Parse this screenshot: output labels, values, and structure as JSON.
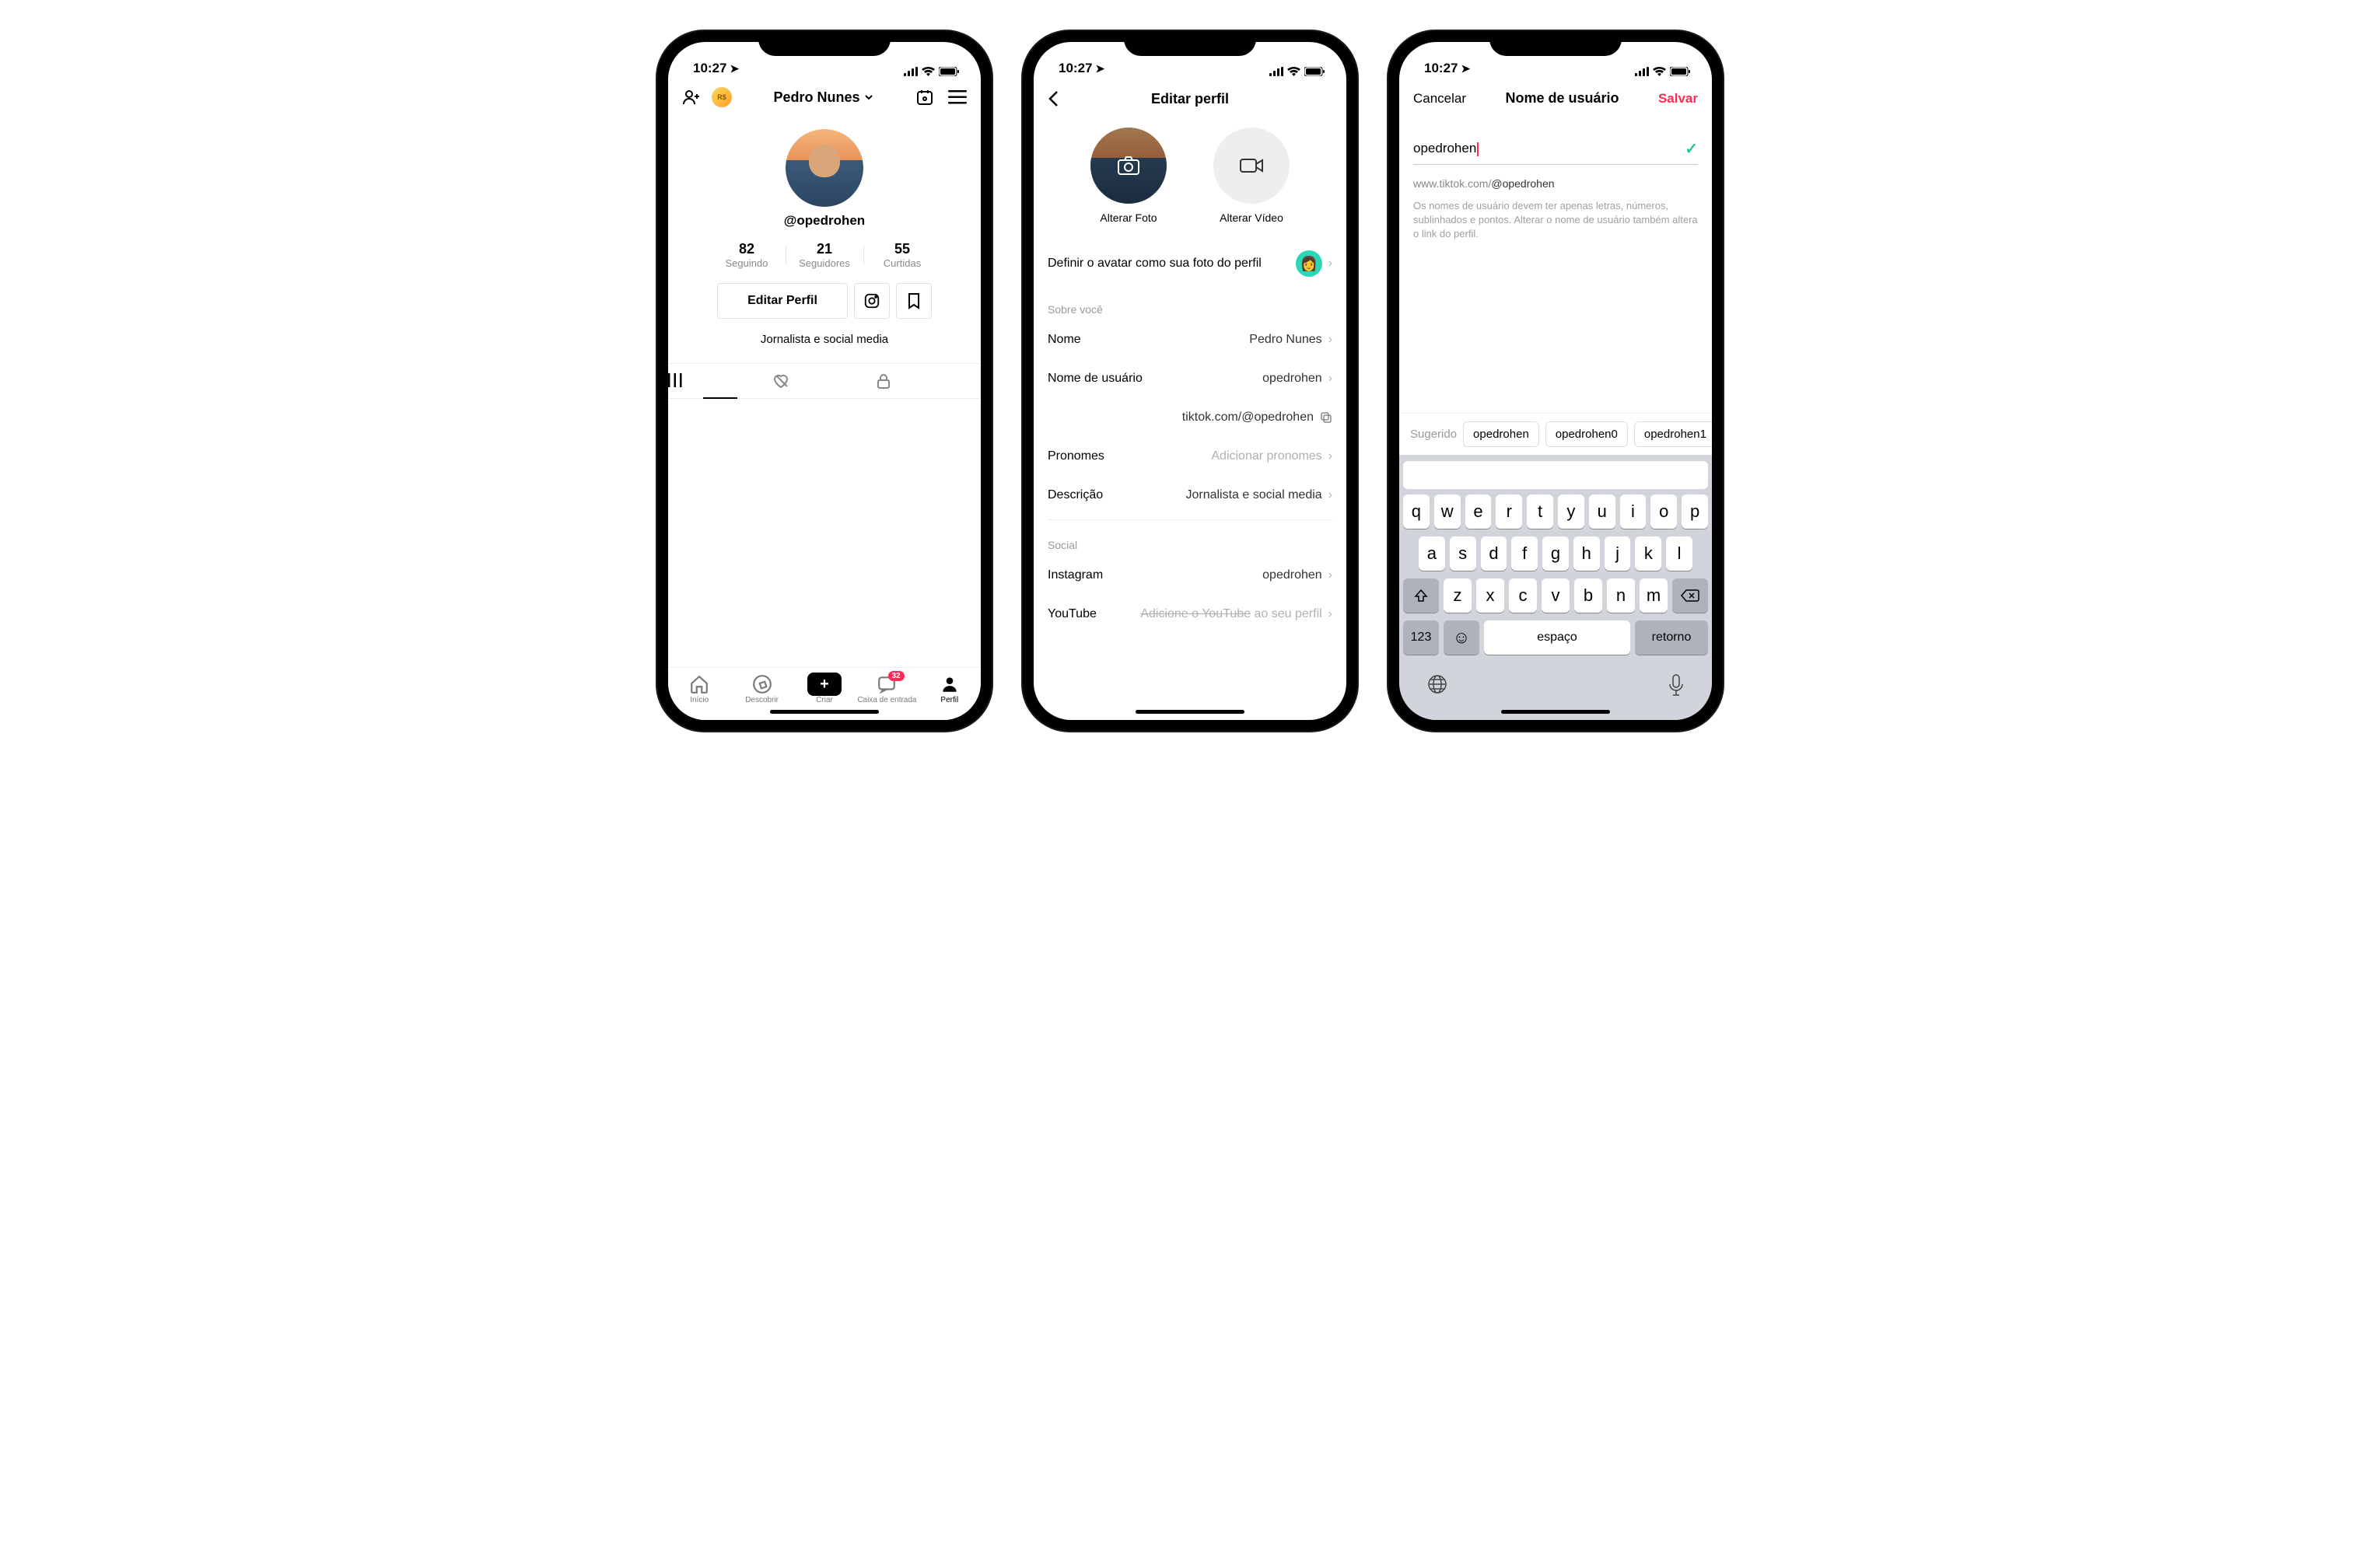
{
  "status": {
    "time": "10:27"
  },
  "phone1": {
    "header": {
      "profile_name": "Pedro Nunes"
    },
    "username": "@opedrohen",
    "stats": {
      "following": {
        "num": "82",
        "label": "Seguindo"
      },
      "followers": {
        "num": "21",
        "label": "Seguidores"
      },
      "likes": {
        "num": "55",
        "label": "Curtidas"
      }
    },
    "edit_button": "Editar Perfil",
    "bio": "Jornalista e social media",
    "nav": {
      "home": "Início",
      "discover": "Descobrir",
      "create": "Criar",
      "inbox": "Caixa de entrada",
      "inbox_badge": "32",
      "profile": "Perfil"
    }
  },
  "phone2": {
    "title": "Editar perfil",
    "media": {
      "photo_label": "Alterar Foto",
      "video_label": "Alterar Vídeo"
    },
    "avatar_row": "Definir o avatar como sua foto do perfil",
    "section_about": "Sobre você",
    "rows": {
      "name": {
        "label": "Nome",
        "value": "Pedro Nunes"
      },
      "username": {
        "label": "Nome de usuário",
        "value": "opedrohen"
      },
      "profile_link": "tiktok.com/@opedrohen",
      "pronouns": {
        "label": "Pronomes",
        "placeholder": "Adicionar pronomes"
      },
      "description": {
        "label": "Descrição",
        "value": "Jornalista e social media"
      }
    },
    "section_social": "Social",
    "social": {
      "instagram": {
        "label": "Instagram",
        "value": "opedrohen"
      },
      "youtube": {
        "label": "YouTube",
        "placeholder_strike": "Adicione o YouTube",
        "placeholder_rest": " ao seu perfil"
      }
    }
  },
  "phone3": {
    "cancel": "Cancelar",
    "title": "Nome de usuário",
    "save": "Salvar",
    "input_value": "opedrohen",
    "url_prefix": "www.tiktok.com/",
    "url_handle": "@opedrohen",
    "help": "Os nomes de usuário devem ter apenas letras, números, sublinhados e pontos. Alterar o nome de usuário também altera o link do perfil.",
    "suggestions": {
      "label": "Sugerido",
      "items": [
        "opedrohen",
        "opedrohen0",
        "opedrohen1"
      ]
    },
    "keyboard": {
      "row1": [
        "q",
        "w",
        "e",
        "r",
        "t",
        "y",
        "u",
        "i",
        "o",
        "p"
      ],
      "row2": [
        "a",
        "s",
        "d",
        "f",
        "g",
        "h",
        "j",
        "k",
        "l"
      ],
      "row3": [
        "z",
        "x",
        "c",
        "v",
        "b",
        "n",
        "m"
      ],
      "k123": "123",
      "space": "espaço",
      "return": "retorno"
    }
  }
}
